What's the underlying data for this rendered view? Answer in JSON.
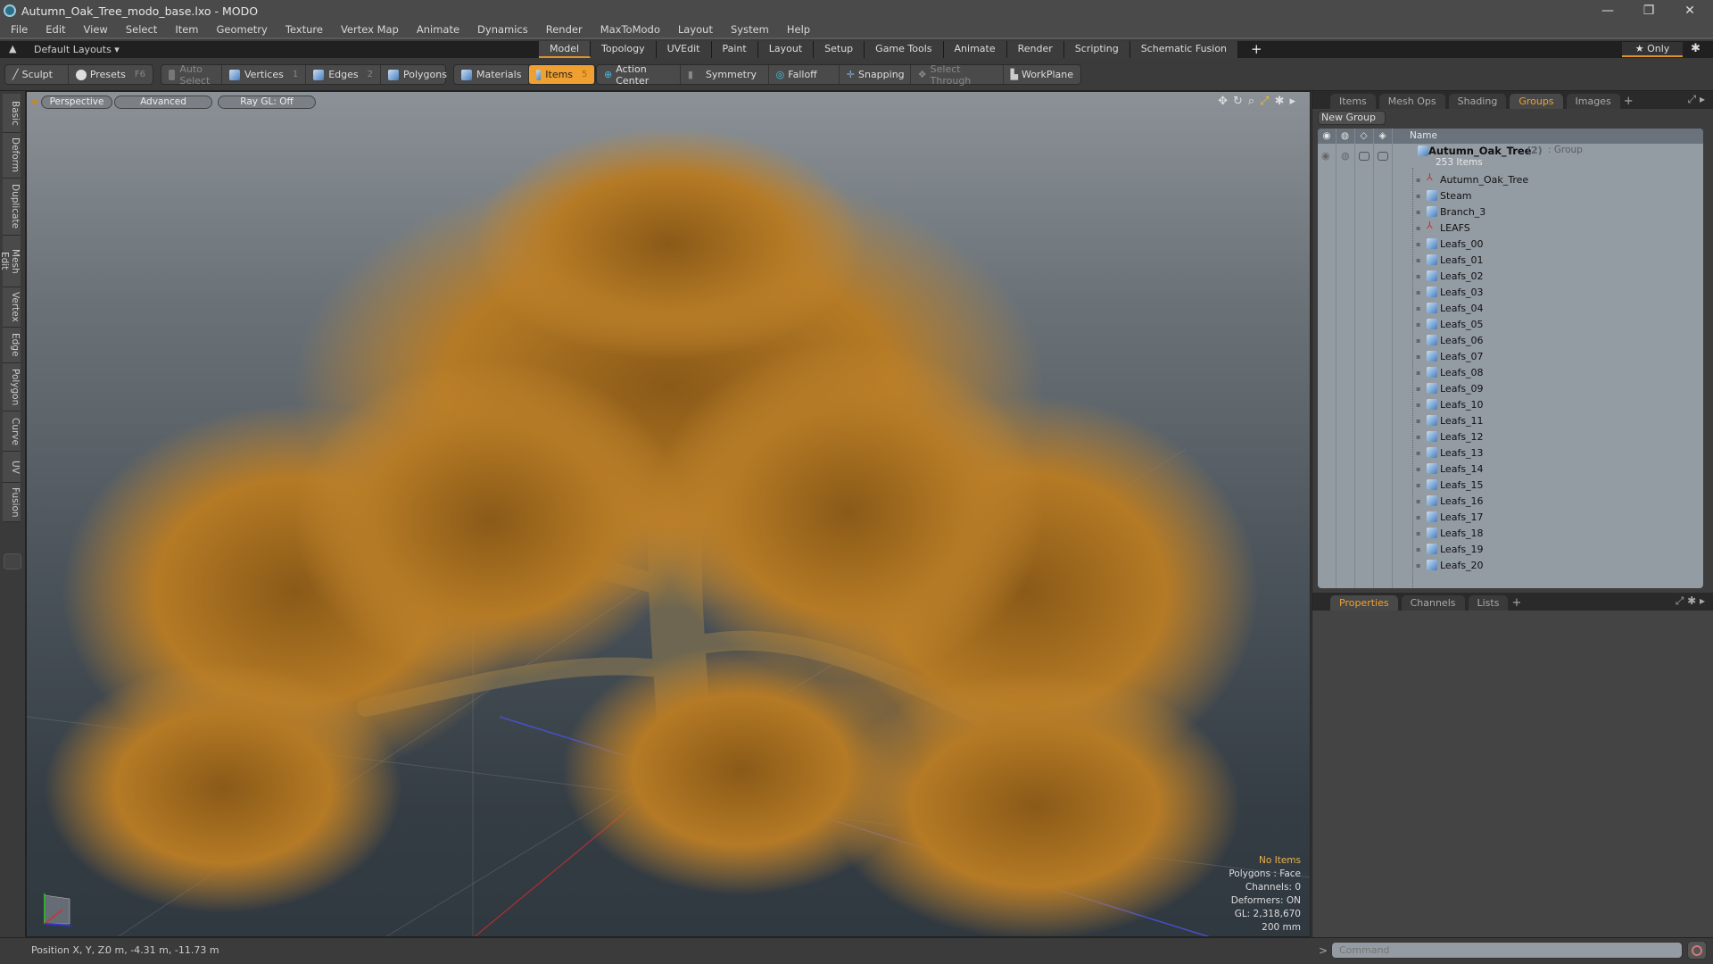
{
  "window": {
    "title": "Autumn_Oak_Tree_modo_base.lxo - MODO",
    "min": "—",
    "max": "❐",
    "close": "✕"
  },
  "menu": [
    "File",
    "Edit",
    "View",
    "Select",
    "Item",
    "Geometry",
    "Texture",
    "Vertex Map",
    "Animate",
    "Dynamics",
    "Render",
    "MaxToModo",
    "Layout",
    "System",
    "Help"
  ],
  "layoutbar": {
    "layout_selector": "Default Layouts ▾",
    "tabs": [
      "Model",
      "Topology",
      "UVEdit",
      "Paint",
      "Layout",
      "Setup",
      "Game Tools",
      "Animate",
      "Render",
      "Scripting",
      "Schematic Fusion"
    ],
    "active_tab": "Model",
    "add": "+",
    "only": "★ Only",
    "gear": "✱"
  },
  "toolbar": {
    "sculpt": "Sculpt",
    "presets": "Presets",
    "presets_key": "F6",
    "auto_select": "Auto Select",
    "vertices": "Vertices",
    "vertices_key": "1",
    "edges": "Edges",
    "edges_key": "2",
    "polygons": "Polygons",
    "materials": "Materials",
    "items": "Items",
    "items_key": "5",
    "action_center": "Action Center",
    "symmetry": "Symmetry",
    "falloff": "Falloff",
    "snapping": "Snapping",
    "select_through": "Select Through",
    "workplane": "WorkPlane"
  },
  "lefttabs": [
    "Basic",
    "Deform",
    "Duplicate",
    "Mesh Edit",
    "Vertex",
    "Edge",
    "Polygon",
    "Curve",
    "UV",
    "Fusion"
  ],
  "viewport": {
    "view": "Perspective",
    "shading": "Advanced",
    "raygl": "Ray GL: Off",
    "hud": {
      "selection": "No Items",
      "polygons": "Polygons : Face",
      "channels": "Channels: 0",
      "deformers": "Deformers: ON",
      "gl": "GL: 2,318,670",
      "scale": "200 mm"
    },
    "colors": {
      "selection": "#e8b24a"
    }
  },
  "rightpanel": {
    "tabs": [
      "Items",
      "Mesh Ops",
      "Shading",
      "Groups",
      "Images"
    ],
    "active_tab": "Groups",
    "add": "+",
    "new_group": "New Group",
    "column_name": "Name",
    "group": {
      "name": "Autumn_Oak_Tree",
      "count": "(2)",
      "type": ": Group",
      "items": "253 Items"
    },
    "items": [
      {
        "name": "Autumn_Oak_Tree",
        "icon": "locator"
      },
      {
        "name": "Steam",
        "icon": "mesh"
      },
      {
        "name": "Branch_3",
        "icon": "mesh"
      },
      {
        "name": "LEAFS",
        "icon": "locator"
      },
      {
        "name": "Leafs_00",
        "icon": "mesh"
      },
      {
        "name": "Leafs_01",
        "icon": "mesh"
      },
      {
        "name": "Leafs_02",
        "icon": "mesh"
      },
      {
        "name": "Leafs_03",
        "icon": "mesh"
      },
      {
        "name": "Leafs_04",
        "icon": "mesh"
      },
      {
        "name": "Leafs_05",
        "icon": "mesh"
      },
      {
        "name": "Leafs_06",
        "icon": "mesh"
      },
      {
        "name": "Leafs_07",
        "icon": "mesh"
      },
      {
        "name": "Leafs_08",
        "icon": "mesh"
      },
      {
        "name": "Leafs_09",
        "icon": "mesh"
      },
      {
        "name": "Leafs_10",
        "icon": "mesh"
      },
      {
        "name": "Leafs_11",
        "icon": "mesh"
      },
      {
        "name": "Leafs_12",
        "icon": "mesh"
      },
      {
        "name": "Leafs_13",
        "icon": "mesh"
      },
      {
        "name": "Leafs_14",
        "icon": "mesh"
      },
      {
        "name": "Leafs_15",
        "icon": "mesh"
      },
      {
        "name": "Leafs_16",
        "icon": "mesh"
      },
      {
        "name": "Leafs_17",
        "icon": "mesh"
      },
      {
        "name": "Leafs_18",
        "icon": "mesh"
      },
      {
        "name": "Leafs_19",
        "icon": "mesh"
      },
      {
        "name": "Leafs_20",
        "icon": "mesh"
      }
    ],
    "bottom_tabs": [
      "Properties",
      "Channels",
      "Lists"
    ],
    "bottom_active": "Properties"
  },
  "statusbar": {
    "position_label": "Position X, Y, Z:",
    "position_value": "0 m, -4.31 m, -11.73 m",
    "command_prompt": ">",
    "command_placeholder": "Command"
  },
  "accent": "#f0a030"
}
